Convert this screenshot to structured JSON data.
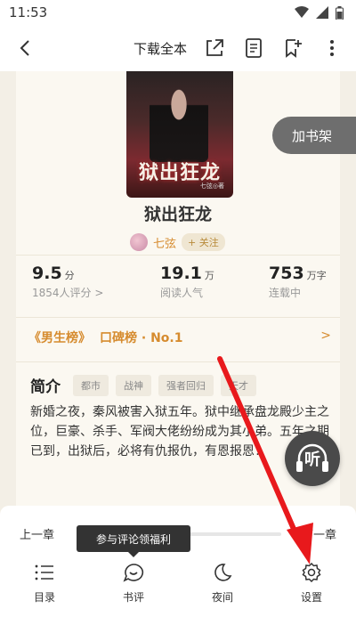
{
  "status_bar": {
    "time": "11:53"
  },
  "nav": {
    "download_label": "下载全本"
  },
  "book": {
    "cover_title": "狱出狂龙",
    "cover_author": "七弦◎著",
    "title": "狱出狂龙",
    "author": "七弦",
    "follow_label": "+ 关注"
  },
  "add_shelf_label": "加书架",
  "stats": {
    "score": {
      "value": "9.5",
      "unit": "分",
      "sub": "1854人评分 >"
    },
    "readers": {
      "value": "19.1",
      "unit": "万",
      "sub": "阅读人气"
    },
    "words": {
      "value": "753",
      "unit": "万字",
      "sub": "连载中"
    }
  },
  "rank": {
    "badge": "《男生榜》",
    "text": "口碑榜 · No.1",
    "arrow": ">"
  },
  "intro": {
    "label": "简介",
    "tags": [
      "都市",
      "战神",
      "强者回归",
      "天才"
    ],
    "body": "新婚之夜，秦风被害入狱五年。狱中继承盘龙殿少主之位，巨豪、杀手、军阀大佬纷纷成为其小弟。五年之期已到，出狱后，必将有仇报仇，有恩报恩！"
  },
  "listen_label": "听",
  "bottom": {
    "prev_chapter": "上一章",
    "next_chapter": "下一章",
    "tooltip": "参与评论领福利",
    "menu": [
      {
        "label": "目录",
        "icon": "list-icon"
      },
      {
        "label": "书评",
        "icon": "comment-icon"
      },
      {
        "label": "夜间",
        "icon": "moon-icon"
      },
      {
        "label": "设置",
        "icon": "gear-icon"
      }
    ]
  },
  "colors": {
    "accent": "#d68b2e",
    "annotation": "#e8191c",
    "shelf_button": "#6e6e6e"
  }
}
